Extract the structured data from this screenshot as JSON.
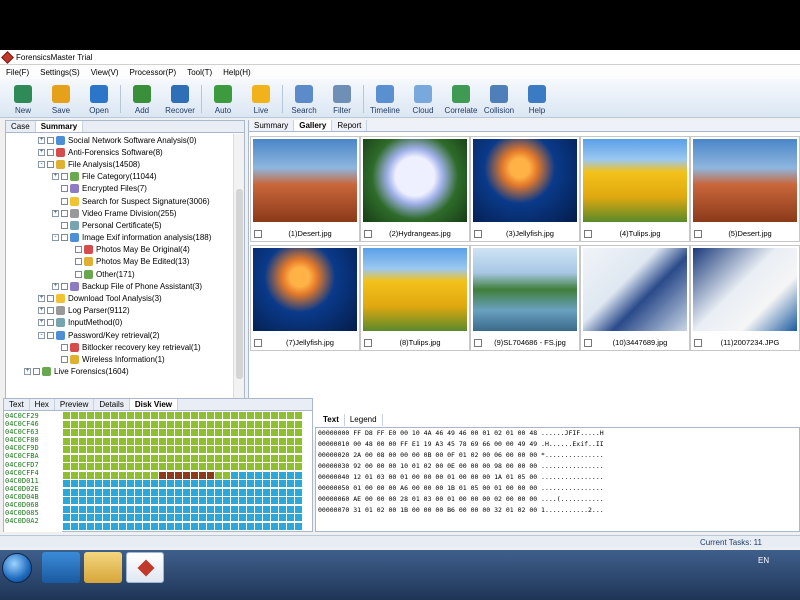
{
  "window": {
    "title": "ForensicsMaster Trial"
  },
  "menu": [
    "File(F)",
    "Settings(S)",
    "View(V)",
    "Processor(P)",
    "Tool(T)",
    "Help(H)"
  ],
  "toolbar": {
    "buttons": [
      {
        "label": "New",
        "icon": "new-icon",
        "color": "#2e8b57"
      },
      {
        "label": "Save",
        "icon": "save-icon",
        "color": "#e6a11a"
      },
      {
        "label": "Open",
        "icon": "open-folder-icon",
        "color": "#2b76c9"
      },
      {
        "label": "Add",
        "icon": "add-icon",
        "color": "#3a8f3a"
      },
      {
        "label": "Recover",
        "icon": "recover-icon",
        "color": "#2f6fb8"
      },
      {
        "label": "Auto",
        "icon": "auto-icon",
        "color": "#3e9a3e"
      },
      {
        "label": "Live",
        "icon": "live-icon",
        "color": "#f2b21c"
      },
      {
        "label": "Search",
        "icon": "search-icon",
        "color": "#5b8cc9"
      },
      {
        "label": "Filter",
        "icon": "filter-icon",
        "color": "#6f8fb7"
      },
      {
        "label": "Timeline",
        "icon": "timeline-icon",
        "color": "#5a8fd0"
      },
      {
        "label": "Cloud",
        "icon": "cloud-icon",
        "color": "#79a8dc"
      },
      {
        "label": "Correlate",
        "icon": "correlate-icon",
        "color": "#3f9a54"
      },
      {
        "label": "Collision",
        "icon": "collision-icon",
        "color": "#4f7fb8"
      },
      {
        "label": "Help",
        "icon": "help-icon",
        "color": "#3b7bc4"
      }
    ]
  },
  "left_tabs": [
    "Case",
    "Summary"
  ],
  "tree": [
    {
      "label": "Social Network Software Analysis(0)",
      "level": 2,
      "expander": "+"
    },
    {
      "label": "Anti-Forensics Software(8)",
      "level": 2,
      "expander": "+"
    },
    {
      "label": "File Analysis(14508)",
      "level": 2,
      "expander": "-"
    },
    {
      "label": "File Category(11044)",
      "level": 3,
      "expander": "+"
    },
    {
      "label": "Encrypted Files(7)",
      "level": 3,
      "expander": ""
    },
    {
      "label": "Search for Suspect Signature(3006)",
      "level": 3,
      "expander": ""
    },
    {
      "label": "Video Frame Division(255)",
      "level": 3,
      "expander": "+"
    },
    {
      "label": "Personal Certificate(5)",
      "level": 3,
      "expander": ""
    },
    {
      "label": "Image Exif information analysis(188)",
      "level": 3,
      "expander": "-"
    },
    {
      "label": "Photos May Be Original(4)",
      "level": 4,
      "expander": ""
    },
    {
      "label": "Photos May Be Edited(13)",
      "level": 4,
      "expander": ""
    },
    {
      "label": "Other(171)",
      "level": 4,
      "expander": ""
    },
    {
      "label": "Backup File of Phone Assistant(3)",
      "level": 3,
      "expander": "+"
    },
    {
      "label": "Download Tool Analysis(3)",
      "level": 2,
      "expander": "+"
    },
    {
      "label": "Log Parser(9112)",
      "level": 2,
      "expander": "+"
    },
    {
      "label": "InputMethod(0)",
      "level": 2,
      "expander": "+"
    },
    {
      "label": "Password/Key retrieval(2)",
      "level": 2,
      "expander": "-"
    },
    {
      "label": "Bitlocker recovery key retrieval(1)",
      "level": 3,
      "expander": ""
    },
    {
      "label": "Wireless Information(1)",
      "level": 3,
      "expander": ""
    },
    {
      "label": "Live Forensics(1604)",
      "level": 1,
      "expander": "+"
    }
  ],
  "right_tabs": [
    "Summary",
    "Gallery",
    "Report"
  ],
  "gallery": [
    {
      "caption": "(1)Desert.jpg",
      "scene": "desert"
    },
    {
      "caption": "(2)Hydrangeas.jpg",
      "scene": "hydrangea"
    },
    {
      "caption": "(3)Jellyfish.jpg",
      "scene": "jellyfish"
    },
    {
      "caption": "(4)Tulips.jpg",
      "scene": "tulips"
    },
    {
      "caption": "(5)Desert.jpg",
      "scene": "desert"
    },
    {
      "caption": "(7)Jellyfish.jpg",
      "scene": "jellyfish"
    },
    {
      "caption": "(8)Tulips.jpg",
      "scene": "tulips"
    },
    {
      "caption": "(9)SL704686 - FS.jpg",
      "scene": "park"
    },
    {
      "caption": "(10)3447689.jpg",
      "scene": "jet"
    },
    {
      "caption": "(11)2007234.JPG",
      "scene": "airliner"
    }
  ],
  "bottom_tabs": [
    "Text",
    "Hex",
    "Preview",
    "Details",
    "Disk View"
  ],
  "disk_addresses": [
    "04C0CF29",
    "04C0CF46",
    "04C0CF63",
    "04C0CF80",
    "04C0CF9D",
    "04C0CFBA",
    "04C0CFD7",
    "04C0CFF4",
    "04C0D011",
    "04C0D02E",
    "04C0D04B",
    "04C0D068",
    "04C0D085",
    "04C0D0A2"
  ],
  "hex_tabs": [
    "Text",
    "Legend"
  ],
  "hex_rows": [
    "00000000 FF D8 FF E0 00 10 4A 46 49 46 00 01 02 01 00 48 ......JFIF.....H",
    "00000010 00 48 00 00 FF E1 19 A3 45 78 69 66 00 00 49 49 .H......Exif..II",
    "00000020 2A 00 08 00 00 00 0B 00 0F 01 02 00 06 00 00 00 *...............",
    "00000030 92 00 00 00 10 01 02 00 0E 00 00 00 98 00 00 00 ................",
    "00000040 12 01 03 00 01 00 00 00 01 00 00 00 1A 01 05 00 ................",
    "00000050 01 00 00 00 A6 00 00 00 1B 01 05 00 01 00 00 00 ................",
    "00000060 AE 00 00 00 28 01 03 00 01 00 00 00 02 00 00 00 ....(...........",
    "00000070 31 01 02 00 1B 00 00 00 B6 00 00 00 32 01 02 00 1...........2..."
  ],
  "status": {
    "current_tasks": "Current Tasks: 11"
  },
  "taskbar": {
    "lang": "EN"
  },
  "colors": {
    "used": "#8fbf2f",
    "free": "#2ba8d8",
    "selected": "#8b3a1a",
    "accent": "#1f6bbf"
  }
}
